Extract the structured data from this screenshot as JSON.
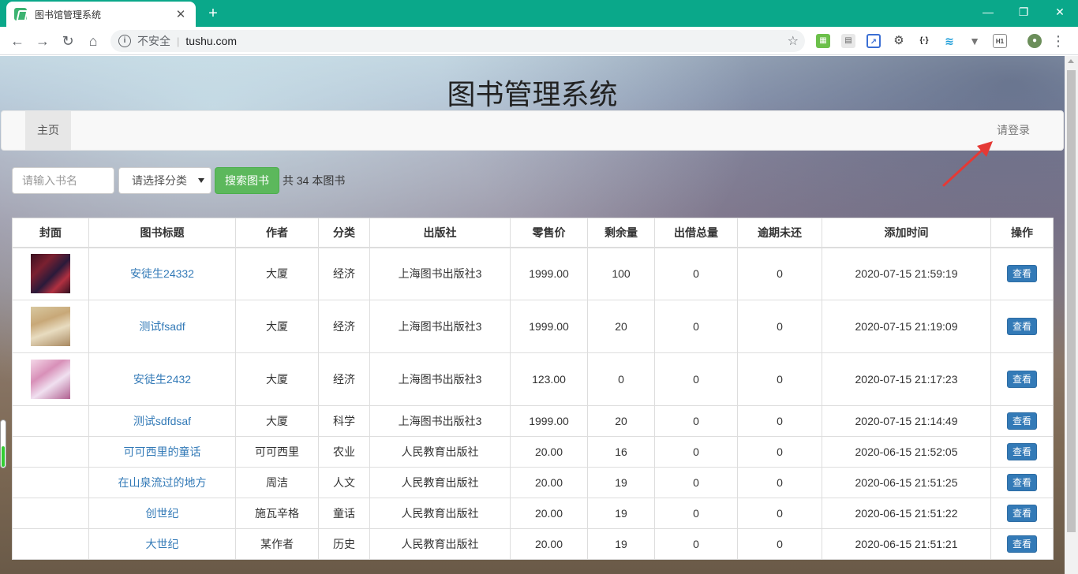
{
  "browser": {
    "tab_title": "图书馆管理系统",
    "tab_close": "✕",
    "new_tab": "+",
    "insecure_label": "不安全",
    "url": "tushu.com",
    "window_controls": {
      "minimize": "—",
      "restore": "❐",
      "close": "✕"
    }
  },
  "site": {
    "title": "图书管理系统",
    "nav": {
      "home": "主页",
      "login": "请登录"
    }
  },
  "search": {
    "placeholder": "请输入书名",
    "category_select": "请选择分类",
    "button": "搜索图书",
    "total": "共 34 本图书"
  },
  "table": {
    "headers": [
      "封面",
      "图书标题",
      "作者",
      "分类",
      "出版社",
      "零售价",
      "剩余量",
      "出借总量",
      "逾期未还",
      "添加时间",
      "操作"
    ],
    "view_label": "查看",
    "rows": [
      {
        "title": "安徒生24332",
        "author": "大厦",
        "category": "经济",
        "publisher": "上海图书出版社3",
        "price": "1999.00",
        "remaining": "100",
        "lent": "0",
        "overdue": "0",
        "added": "2020-07-15 21:59:19",
        "cover": "c1"
      },
      {
        "title": "测试fsadf",
        "author": "大厦",
        "category": "经济",
        "publisher": "上海图书出版社3",
        "price": "1999.00",
        "remaining": "20",
        "lent": "0",
        "overdue": "0",
        "added": "2020-07-15 21:19:09",
        "cover": "c2"
      },
      {
        "title": "安徒生2432",
        "author": "大厦",
        "category": "经济",
        "publisher": "上海图书出版社3",
        "price": "123.00",
        "remaining": "0",
        "lent": "0",
        "overdue": "0",
        "added": "2020-07-15 21:17:23",
        "cover": "c3"
      },
      {
        "title": "测试sdfdsaf",
        "author": "大厦",
        "category": "科学",
        "publisher": "上海图书出版社3",
        "price": "1999.00",
        "remaining": "20",
        "lent": "0",
        "overdue": "0",
        "added": "2020-07-15 21:14:49",
        "cover": ""
      },
      {
        "title": "可可西里的童话",
        "author": "可可西里",
        "category": "农业",
        "publisher": "人民教育出版社",
        "price": "20.00",
        "remaining": "16",
        "lent": "0",
        "overdue": "0",
        "added": "2020-06-15 21:52:05",
        "cover": ""
      },
      {
        "title": "在山泉流过的地方",
        "author": "周洁",
        "category": "人文",
        "publisher": "人民教育出版社",
        "price": "20.00",
        "remaining": "19",
        "lent": "0",
        "overdue": "0",
        "added": "2020-06-15 21:51:25",
        "cover": ""
      },
      {
        "title": "创世纪",
        "author": "施瓦辛格",
        "category": "童话",
        "publisher": "人民教育出版社",
        "price": "20.00",
        "remaining": "19",
        "lent": "0",
        "overdue": "0",
        "added": "2020-06-15 21:51:22",
        "cover": ""
      },
      {
        "title": "大世纪",
        "author": "某作者",
        "category": "历史",
        "publisher": "人民教育出版社",
        "price": "20.00",
        "remaining": "19",
        "lent": "0",
        "overdue": "0",
        "added": "2020-06-15 21:51:21",
        "cover": ""
      }
    ]
  },
  "colors": {
    "tabbar": "#0aa88a",
    "primary": "#337ab7",
    "success": "#5cb85c",
    "arrow": "#e53935"
  }
}
